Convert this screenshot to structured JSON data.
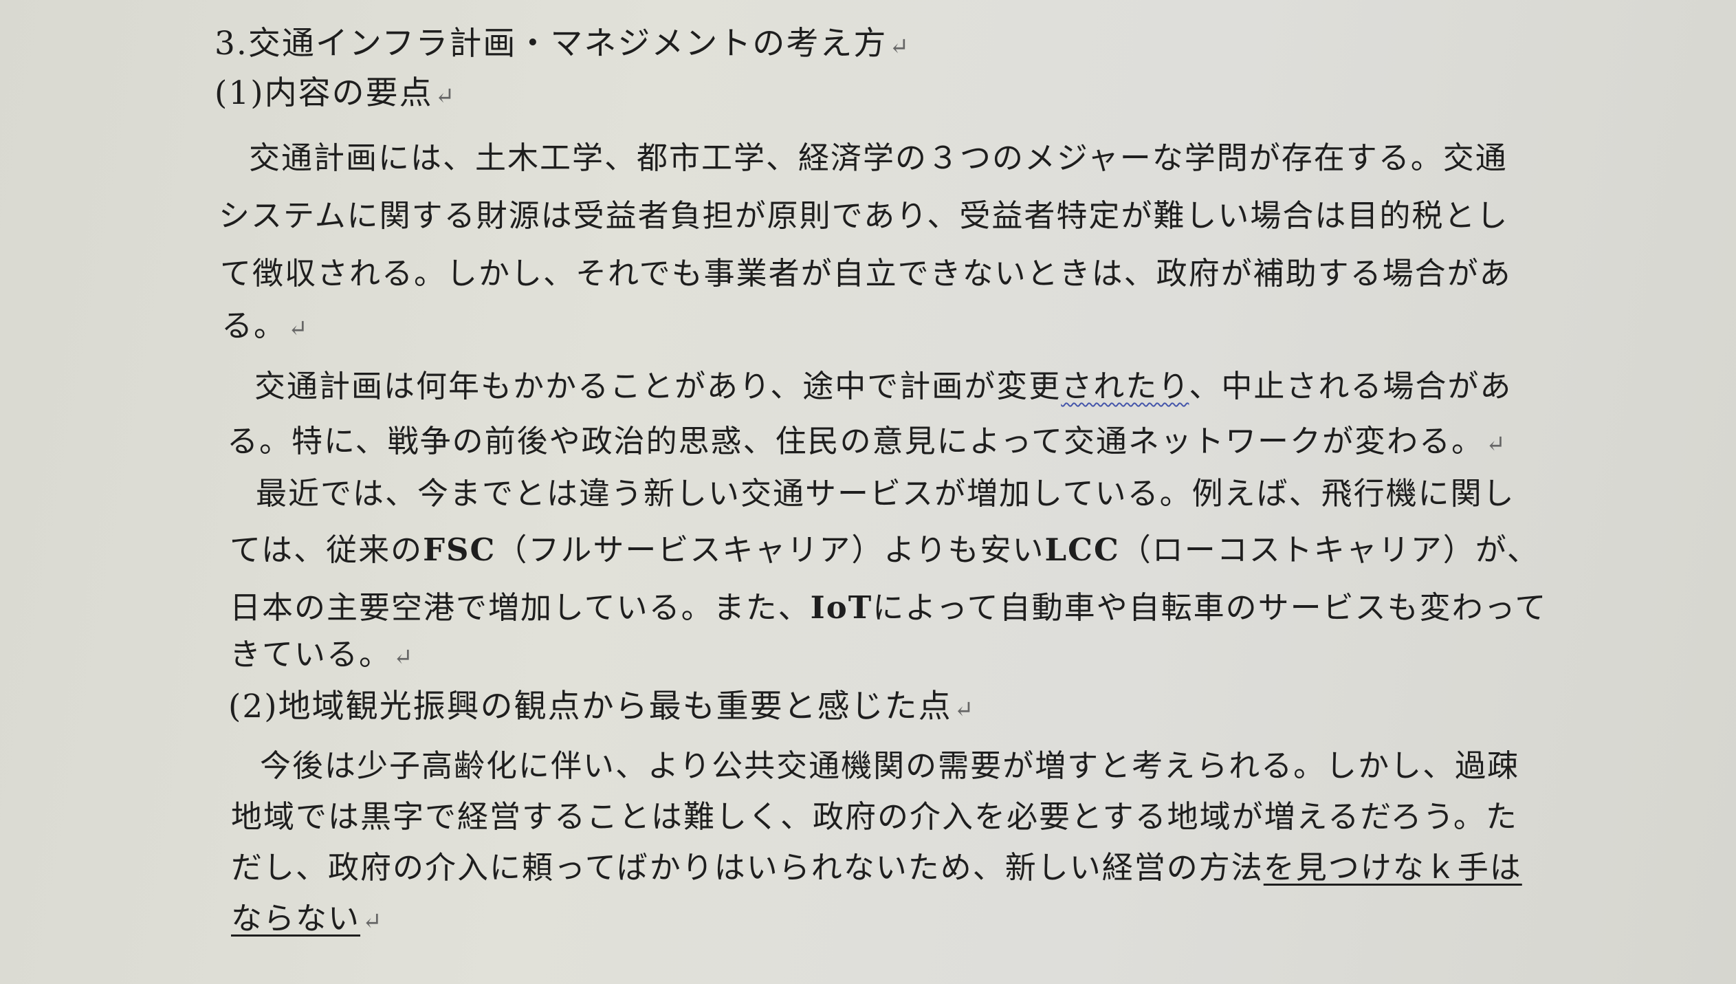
{
  "doc": {
    "title": "3.交通インフラ計画・マネジメントの考え方",
    "section1_heading": "(1)内容の要点",
    "p1": {
      "l1": "交通計画には、土木工学、都市工学、経済学の３つのメジャーな学問が存在する。交通",
      "l2": "システムに関する財源は受益者負担が原則であり、受益者特定が難しい場合は目的税とし",
      "l3": "て徴収される。しかし、それでも事業者が自立できないときは、政府が補助する場合があ",
      "l4": "る。"
    },
    "p2": {
      "l1_a": "交通計画は何年もかかることがあり、途中で計画が変更",
      "l1_b": "されたり",
      "l1_c": "、中止される場合があ",
      "l2": "る。特に、戦争の前後や政治的思惑、住民の意見によって交通ネットワークが変わる。"
    },
    "p3": {
      "l1": "最近では、今までとは違う新しい交通サービスが増加している。例えば、飛行機に関し",
      "l2_a": "ては、従来の",
      "l2_b": "FSC",
      "l2_c": "（フルサービスキャリア）よりも安い",
      "l2_d": "LCC",
      "l2_e": "（ローコストキャリア）が、",
      "l3_a": "日本の主要空港で増加している。また、",
      "l3_b": "IoT",
      "l3_c": "によって自動車や自転車のサービスも変わって",
      "l4": "きている。"
    },
    "section2_heading": "(2)地域観光振興の観点から最も重要と感じた点",
    "p4": {
      "l1": "今後は少子高齢化に伴い、より公共交通機関の需要が増すと考えられる。しかし、過疎",
      "l2": "地域では黒字で経営することは難しく、政府の介入を必要とする地域が増えるだろう。た",
      "l3_a": "だし、政府の介入に頼ってばかりはいられないため、新しい経営の方法",
      "l3_b": "を見つけなｋ手は",
      "l4": "ならない"
    },
    "return_mark": "↵"
  }
}
